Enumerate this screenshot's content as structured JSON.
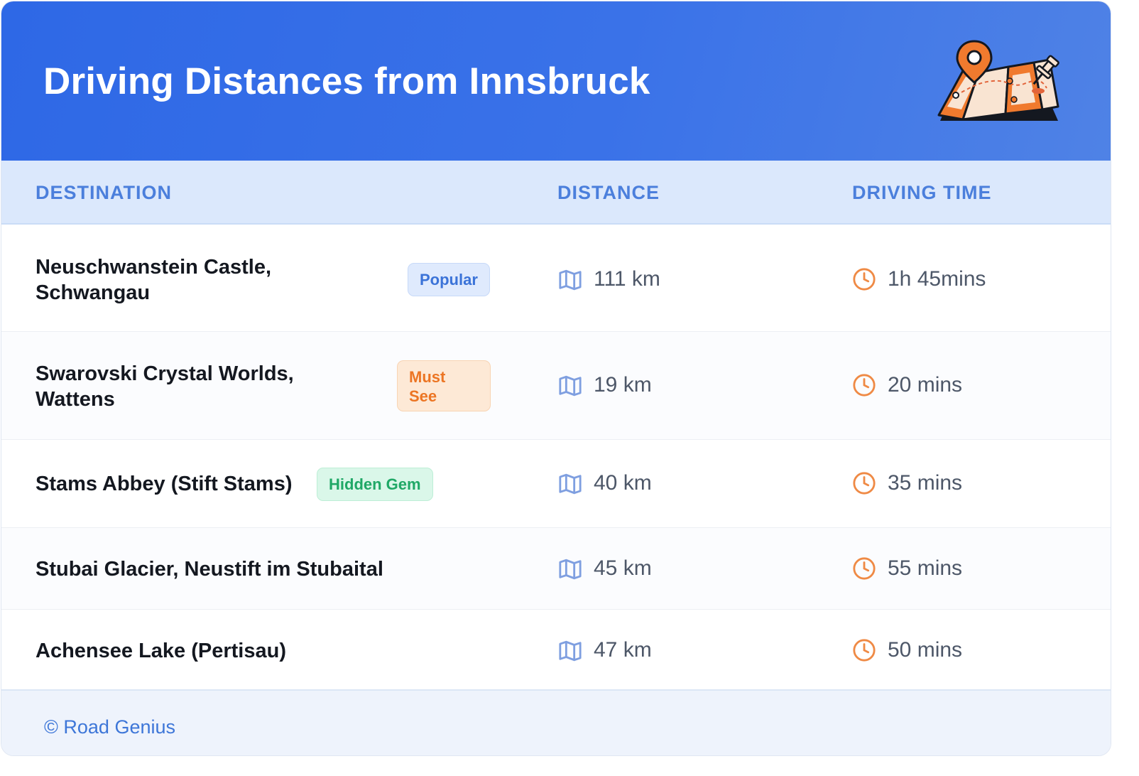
{
  "header": {
    "title": "Driving Distances from Innsbruck",
    "illustration_icon": "map-with-pins-icon"
  },
  "columns": {
    "destination": "DESTINATION",
    "distance": "DISTANCE",
    "driving_time": "DRIVING TIME"
  },
  "icons": {
    "distance": "map-icon",
    "time": "clock-icon"
  },
  "rows": [
    {
      "destination_line1": "Neuschwanstein Castle,",
      "destination_line2": "Schwangau",
      "badge": "Popular",
      "badge_color": "blue",
      "distance": "111 km",
      "time": "1h 45mins"
    },
    {
      "destination_line1": "Swarovski Crystal Worlds,",
      "destination_line2": "Wattens",
      "badge_line1": "Must",
      "badge_line2": "See",
      "badge_color": "orange",
      "distance": "19 km",
      "time": "20 mins"
    },
    {
      "destination": "Stams Abbey (Stift Stams)",
      "badge": "Hidden Gem",
      "badge_color": "green",
      "distance": "40 km",
      "time": "35 mins"
    },
    {
      "destination": "Stubai Glacier, Neustift im Stubaital",
      "distance": "45 km",
      "time": "55 mins"
    },
    {
      "destination": "Achensee Lake (Pertisau)",
      "distance": "47 km",
      "time": "50 mins"
    }
  ],
  "footer": {
    "credit": "© Road Genius"
  },
  "colors": {
    "header_start": "#2e68e6",
    "header_end": "#4f82e6",
    "accent_blue": "#4b7fdc",
    "clock_orange": "#ef8a45",
    "map_icon_blue": "#7f9fe0"
  }
}
